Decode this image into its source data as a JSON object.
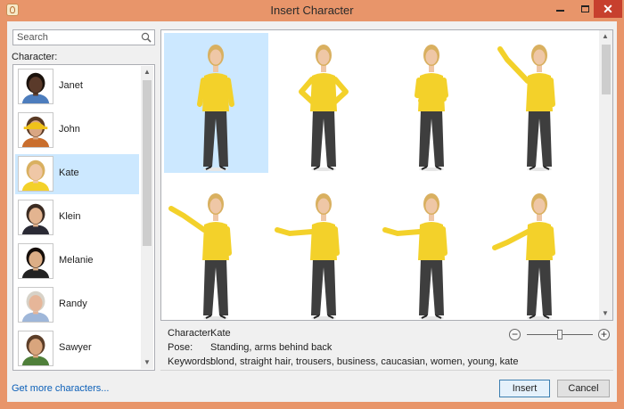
{
  "window": {
    "title": "Insert Character",
    "close_glyph": "✕"
  },
  "search": {
    "placeholder": "Search"
  },
  "character_label": "Character:",
  "characters": [
    {
      "name": "Janet",
      "skin": "#5a3a2a",
      "hair": "#1b120c",
      "shirt": "#4d7dbd",
      "hat": ""
    },
    {
      "name": "John",
      "skin": "#d9a683",
      "hair": "#5a3a24",
      "shirt": "#c96e2d",
      "hat": "#f0c21a"
    },
    {
      "name": "Kate",
      "skin": "#efc7a6",
      "hair": "#d9b060",
      "shirt": "#f3d12a",
      "hat": ""
    },
    {
      "name": "Klein",
      "skin": "#e3b490",
      "hair": "#3b2b22",
      "shirt": "#2a2a35",
      "hat": ""
    },
    {
      "name": "Melanie",
      "skin": "#dcae86",
      "hair": "#150e0a",
      "shirt": "#222222",
      "hat": ""
    },
    {
      "name": "Randy",
      "skin": "#e6b699",
      "hair": "#d7d2c8",
      "shirt": "#9fb7d9",
      "hat": ""
    },
    {
      "name": "Sawyer",
      "skin": "#d9a57d",
      "hair": "#5c3e28",
      "shirt": "#4f7f3a",
      "hat": ""
    }
  ],
  "selected_character_index": 2,
  "poses": [
    {
      "pose": "arms-behind-back",
      "selected": true
    },
    {
      "pose": "hands-on-hips",
      "selected": false
    },
    {
      "pose": "arms-crossed",
      "selected": false
    },
    {
      "pose": "pointing-up-right",
      "selected": false
    },
    {
      "pose": "pointing-up-left",
      "selected": false
    },
    {
      "pose": "pointing-left",
      "selected": false
    },
    {
      "pose": "pointing-left",
      "selected": false
    },
    {
      "pose": "pointing-down-left",
      "selected": false
    }
  ],
  "details": {
    "character_key": "Character:",
    "character_value": "Kate",
    "pose_key": "Pose:",
    "pose_value": "Standing, arms behind back",
    "keywords_key": "Keywords:",
    "keywords_value": "blond, straight hair, trousers, business, caucasian, women, young, kate"
  },
  "zoom": {
    "minus": "−",
    "plus": "+",
    "level": 0.5
  },
  "footer": {
    "link": "Get more characters...",
    "insert": "Insert",
    "cancel": "Cancel"
  },
  "colors": {
    "selection": "#cce8ff",
    "title_bar": "#e8956a",
    "link": "#0b5fb8"
  }
}
